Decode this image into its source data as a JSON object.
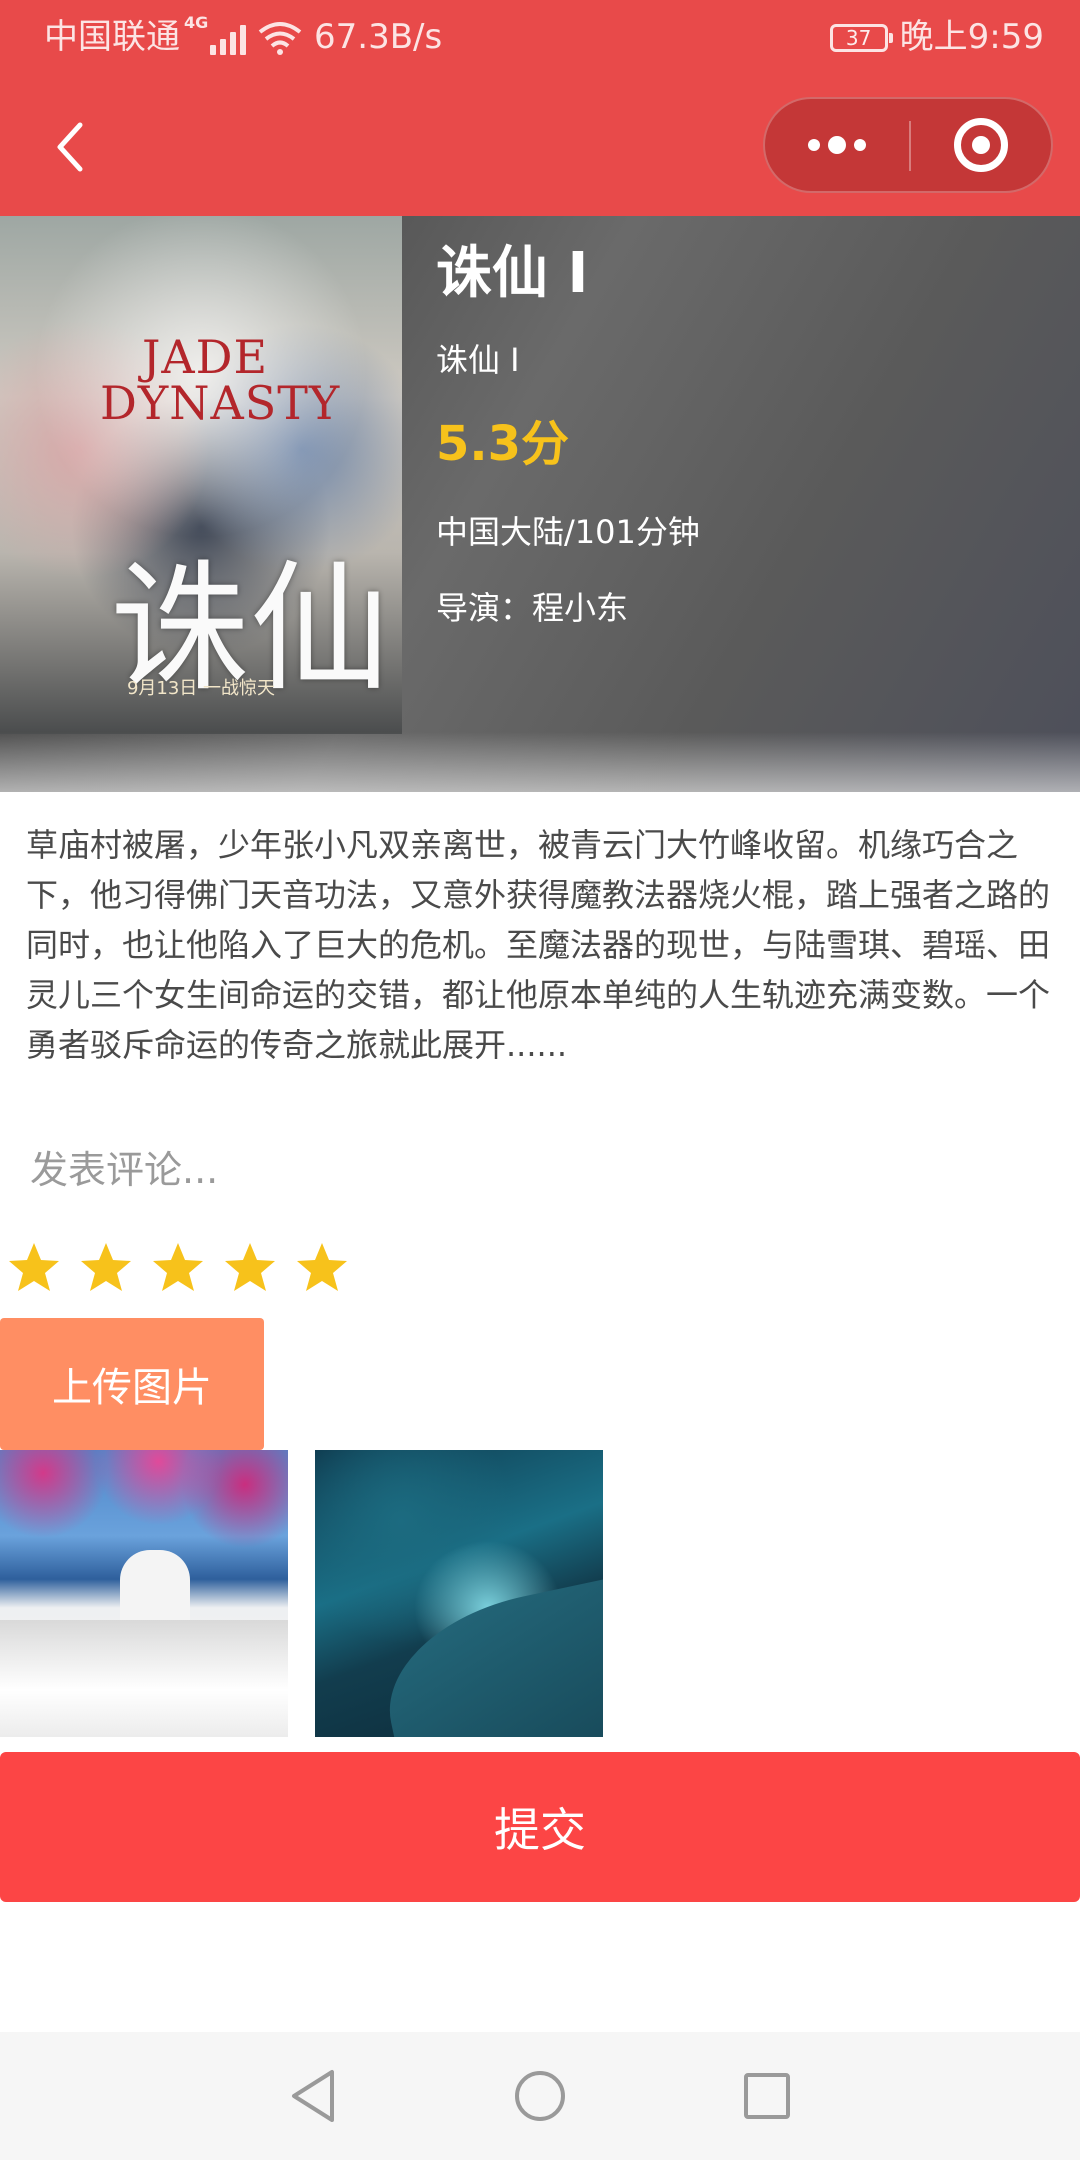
{
  "status_bar": {
    "carrier": "中国联通",
    "network": "4G",
    "speed": "67.3B/s",
    "battery": "37",
    "time": "晚上9:59"
  },
  "nav": {
    "back_icon": "chevron-left-icon",
    "more_icon": "more-dots-icon",
    "close_icon": "target-ring-icon"
  },
  "movie": {
    "poster_title": "JADE DYNASTY",
    "poster_glyph": "诛仙",
    "poster_date": "9月13日 一战惊天",
    "title": "诛仙 Ⅰ",
    "subtitle": "诛仙 Ⅰ",
    "score": "5.3分",
    "region_duration": "中国大陆/101分钟",
    "director": "导演：程小东"
  },
  "synopsis": "草庙村被屠，少年张小凡双亲离世，被青云门大竹峰收留。机缘巧合之下，他习得佛门天音功法，又意外获得魔教法器烧火棍，踏上强者之路的同时，也让他陷入了巨大的危机。至魔法器的现世，与陆雪琪、碧瑶、田灵儿三个女生间命运的交错，都让他原本单纯的人生轨迹充满变数。一个勇者驳斥命运的传奇之旅就此展开......",
  "comment": {
    "placeholder": "发表评论...",
    "value": ""
  },
  "rating": {
    "stars": 5,
    "max": 5,
    "color": "#f7c21b"
  },
  "upload": {
    "label": "上传图片",
    "color": "#ff8e63"
  },
  "thumbnails": [
    {
      "alt": "Santorini windmill terrace"
    },
    {
      "alt": "Blue ice cave"
    }
  ],
  "submit": {
    "label": "提交",
    "color": "#fc4545"
  },
  "theme": {
    "primary": "#e84a4a"
  }
}
